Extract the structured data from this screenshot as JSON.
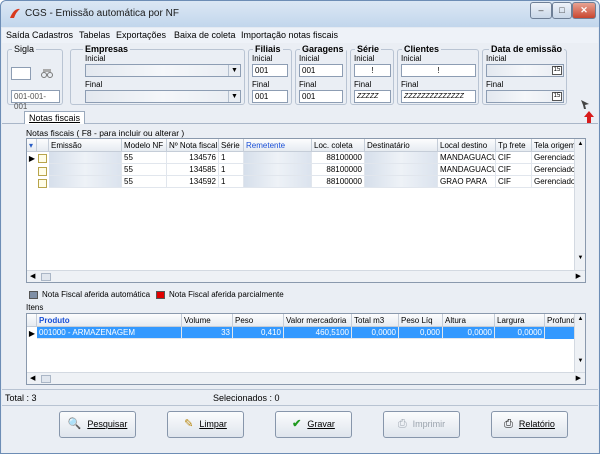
{
  "window": {
    "title": "CGS - Emissão automática por NF",
    "min": "–",
    "max": "□",
    "close": "✕"
  },
  "menu": [
    "Saída",
    "Cadastros",
    "Tabelas",
    "Exportações",
    "Baixa de coleta",
    "Importação notas fiscais"
  ],
  "filters": {
    "sigla": {
      "title": "Sigla",
      "final_value": "001-001-001"
    },
    "empresas": {
      "title": "Empresas",
      "inicial": "Inicial",
      "final": "Final"
    },
    "filiais": {
      "title": "Filiais",
      "inicial": "Inicial",
      "inicial_value": "001",
      "final": "Final",
      "final_value": "001"
    },
    "garagens": {
      "title": "Garagens",
      "inicial": "Inicial",
      "inicial_value": "001",
      "final": "Final",
      "final_value": "001"
    },
    "serie": {
      "title": "Série",
      "inicial": "Inicial",
      "inicial_value": "!",
      "final": "Final",
      "final_value": "ZZZZZ"
    },
    "clientes": {
      "title": "Clientes",
      "inicial": "Inicial",
      "inicial_value": "!",
      "final": "Final",
      "final_value": "ZZZZZZZZZZZZZZ"
    },
    "data": {
      "title": "Data de emissão",
      "inicial": "Inicial",
      "final": "Final"
    }
  },
  "tab": {
    "label": "Notas fiscais"
  },
  "notes_hint": "Notas fiscais ( F8 - para incluir ou alterar )",
  "nf_columns": [
    "Emissão",
    "Modelo NF",
    "Nº Nota fiscal",
    "Série",
    "Remetente",
    "Loc. coleta",
    "Destinatário",
    "Local destino",
    "Tp frete",
    "Tela origem"
  ],
  "nf_rows": [
    {
      "modelo": "55",
      "numero": "134576",
      "serie": "1",
      "loc": "88100000",
      "destino": "MANDAGUACU",
      "frete": "CIF",
      "origem": "Gerenciador de s"
    },
    {
      "modelo": "55",
      "numero": "134585",
      "serie": "1",
      "loc": "88100000",
      "destino": "MANDAGUACU",
      "frete": "CIF",
      "origem": "Gerenciador de s"
    },
    {
      "modelo": "55",
      "numero": "134592",
      "serie": "1",
      "loc": "88100000",
      "destino": "GRAO PARA",
      "frete": "CIF",
      "origem": "Gerenciador de s"
    }
  ],
  "legend": {
    "auto": "Nota Fiscal aferida automática",
    "parcial": "Nota Fiscal aferida parcialmente",
    "auto_color": "#7f8fa6",
    "parcial_color": "#e00000"
  },
  "itens_label": "Itens",
  "item_columns": [
    "Produto",
    "Volume",
    "Peso",
    "Valor mercadoria",
    "Total m3",
    "Peso Líq",
    "Altura",
    "Largura",
    "Profundi"
  ],
  "item_rows": [
    {
      "produto": "001000 - ARMAZENAGEM",
      "volume": "33",
      "peso": "0,410",
      "valor": "460,5100",
      "m3": "0,0000",
      "liq": "0,000",
      "altura": "0,0000",
      "largura": "0,0000"
    }
  ],
  "status": {
    "total": "Total : 3",
    "selecionados": "Selecionados : 0"
  },
  "buttons": {
    "pesquisar": "Pesquisar",
    "limpar": "Limpar",
    "gravar": "Gravar",
    "imprimir": "Imprimir",
    "relatorio": "Relatório"
  },
  "icons": {
    "app": "app-logo-icon",
    "dropdown": "dropdown-arrow-icon",
    "calendar": "calendar-icon",
    "search": "search-icon",
    "clear": "eraser-icon",
    "save": "checkmark-icon",
    "print": "printer-icon",
    "report": "report-icon",
    "up": "red-up-arrow-icon",
    "filter": "filter-icon"
  },
  "colors": {
    "selected_row": "#3399ff",
    "remetente_header": "#1a4fd6"
  }
}
